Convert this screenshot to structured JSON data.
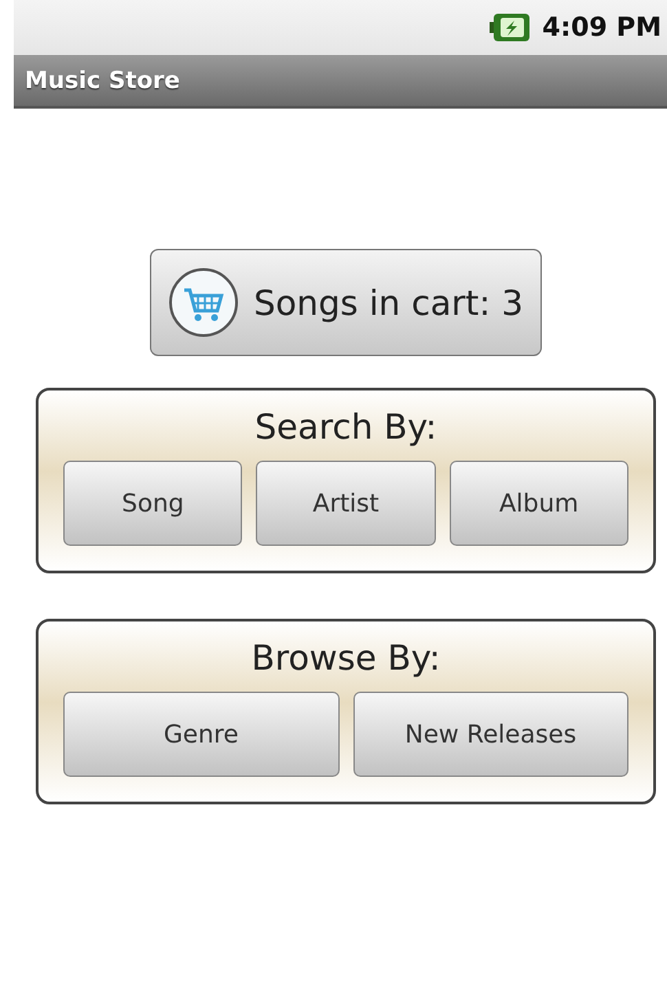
{
  "status_bar": {
    "time": "4:09 PM"
  },
  "window": {
    "title": "Music Store"
  },
  "cart_button": {
    "label": "Songs in cart: 3"
  },
  "panels": [
    {
      "title": "Search By:",
      "buttons": [
        "Song",
        "Artist",
        "Album"
      ]
    },
    {
      "title": "Browse By:",
      "buttons": [
        "Genre",
        "New Releases"
      ]
    }
  ]
}
